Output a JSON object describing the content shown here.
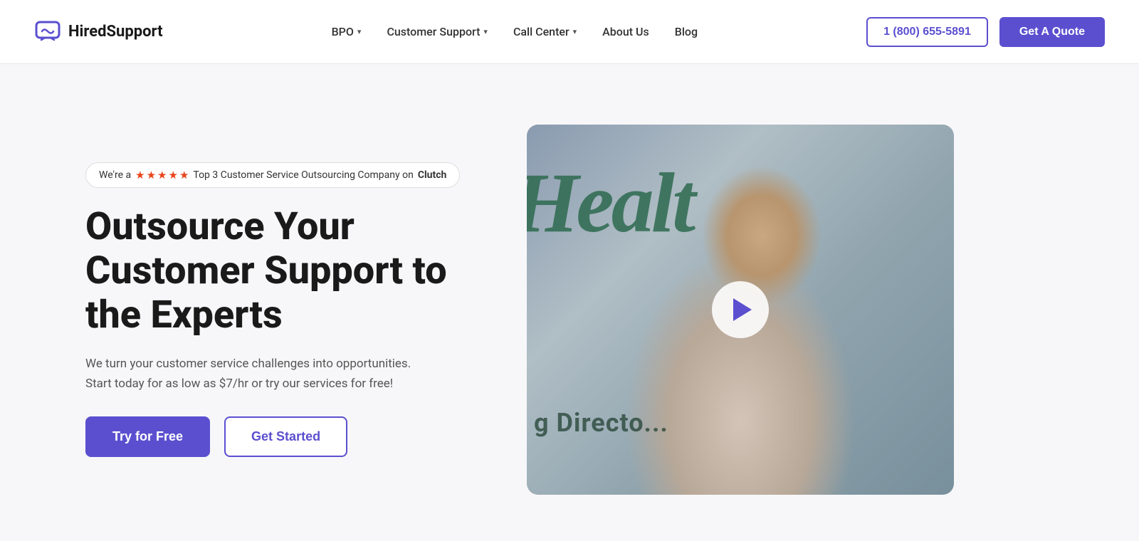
{
  "header": {
    "logo_text": "HiredSupport",
    "nav": [
      {
        "label": "BPO",
        "has_dropdown": true
      },
      {
        "label": "Customer Support",
        "has_dropdown": true
      },
      {
        "label": "Call Center",
        "has_dropdown": true
      },
      {
        "label": "About Us",
        "has_dropdown": false
      },
      {
        "label": "Blog",
        "has_dropdown": false
      }
    ],
    "phone": "1 (800) 655-5891",
    "quote_label": "Get A Quote"
  },
  "hero": {
    "badge_text_prefix": "We're a",
    "badge_text_suffix": "Top 3 Customer Service Outsourcing Company on",
    "badge_brand": "Clutch",
    "title": "Outsource Your Customer Support to the Experts",
    "subtitle": "We turn your customer service challenges into opportunities. Start today for as low as $7/hr or try our services for free!",
    "cta_primary": "Try for Free",
    "cta_secondary": "Get Started",
    "video_bg_text": "Healt",
    "video_bg_text2": "g Directo..."
  }
}
